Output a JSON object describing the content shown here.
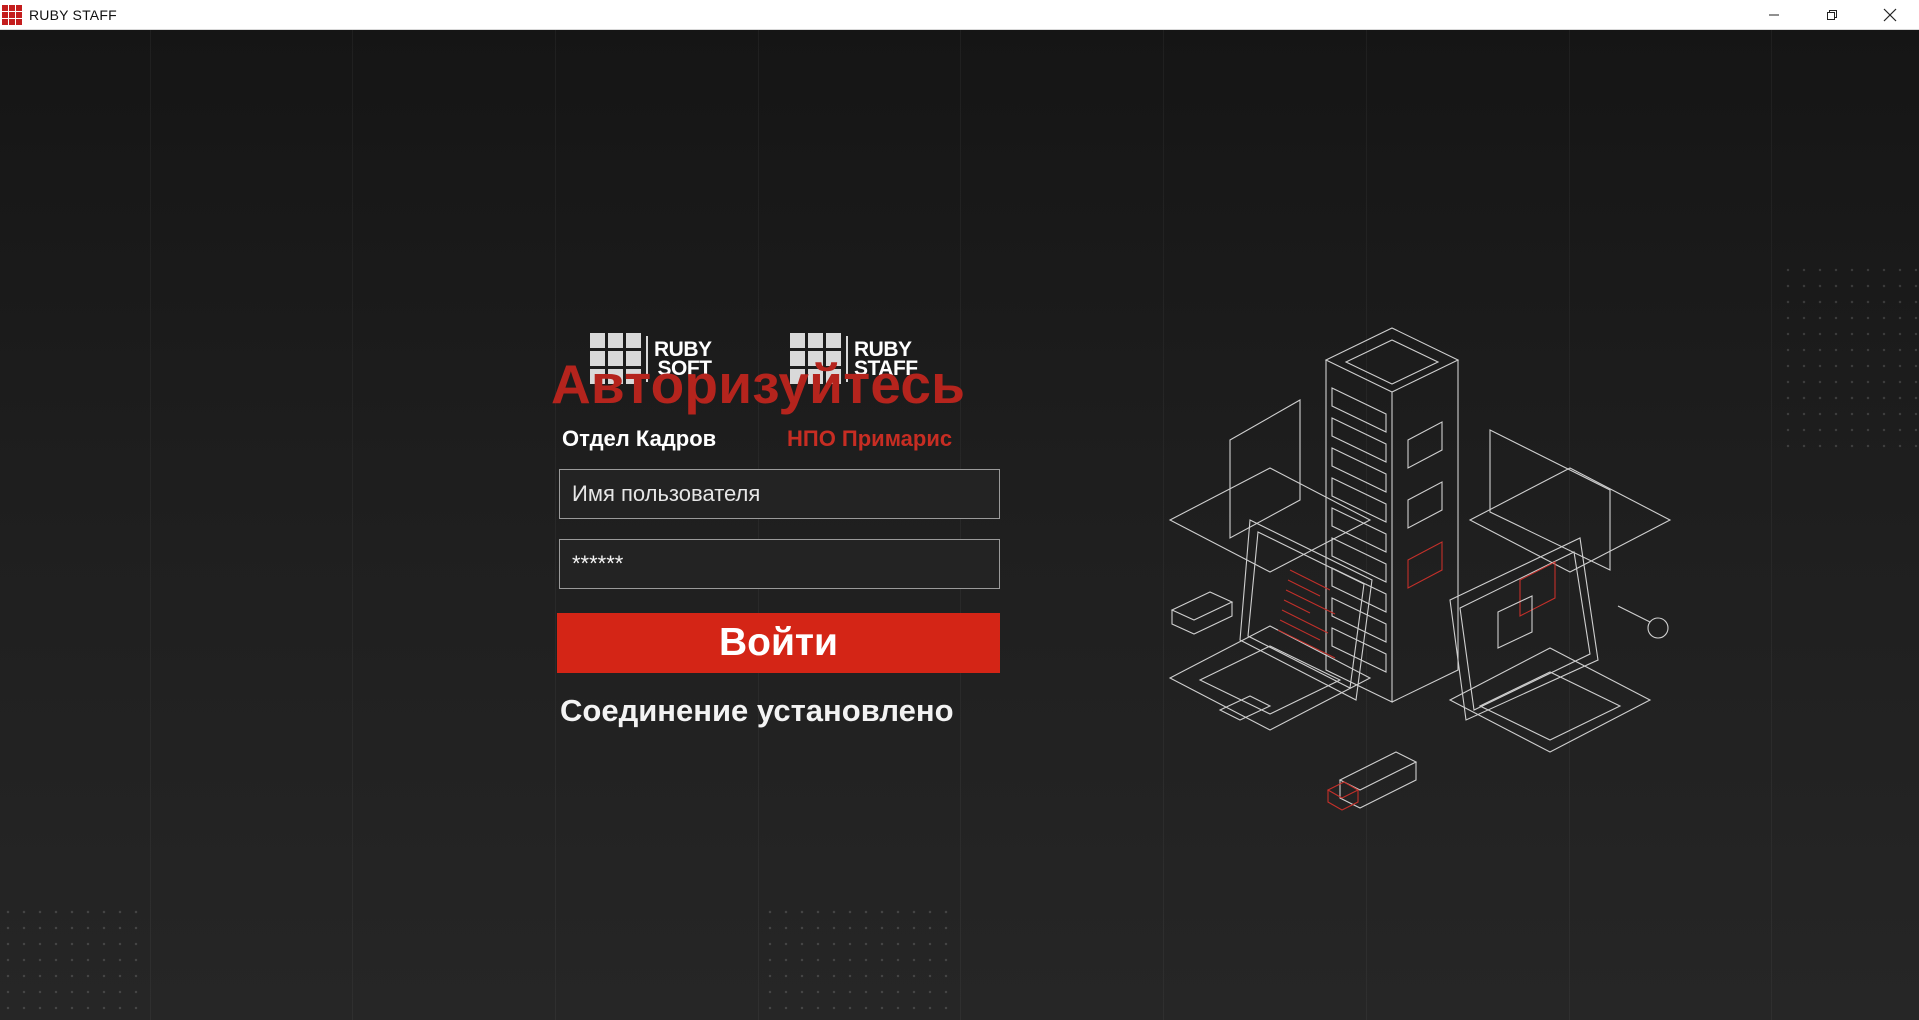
{
  "window": {
    "title": "RUBY STAFF",
    "controls": [
      "minimize-icon",
      "restore-icon",
      "close-icon"
    ]
  },
  "logos": [
    {
      "line1": "RUBY",
      "line2": "SOFT"
    },
    {
      "line1": "RUBY",
      "line2": "STAFF"
    }
  ],
  "login": {
    "heading": "Авторизуйтесь",
    "department": "Отдел Кадров",
    "organization": "НПО Примарис",
    "username_placeholder": "Имя пользователя",
    "username_value": "",
    "password_value": "******",
    "submit_label": "Войти",
    "status": "Соединение установлено"
  },
  "colors": {
    "accent_red": "#d42516",
    "heading_red": "#b5241d",
    "background": "#1d1d1d"
  },
  "illustration": {
    "icon": "server-network-illustration"
  }
}
